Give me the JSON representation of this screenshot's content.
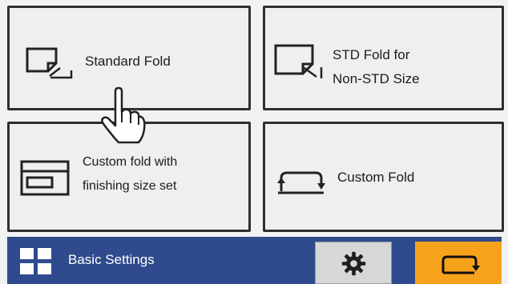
{
  "tiles": {
    "standard_fold": {
      "label": "Standard Fold",
      "icon": "standard-fold-icon"
    },
    "std_fold_non_std": {
      "line1": "STD Fold for",
      "line2": "Non-STD Size",
      "icon": "std-fold-non-std-size-icon"
    },
    "custom_fold_finishing": {
      "line1": "Custom fold with",
      "line2": "finishing size set",
      "icon": "custom-fold-finishing-size-icon"
    },
    "custom_fold": {
      "label": "Custom Fold",
      "icon": "custom-fold-icon"
    }
  },
  "bottom_bar": {
    "title": "Basic Settings",
    "home_icon": "grid-icon",
    "settings_icon": "gear-icon",
    "fold_icon": "fold-icon"
  },
  "colors": {
    "bar": "#2f4b8e",
    "fold_button": "#f7a21b",
    "settings_button": "#d7d7d7",
    "tile": "#efefef",
    "border": "#2f2f2f"
  },
  "cursor": "hand-pointer-icon"
}
